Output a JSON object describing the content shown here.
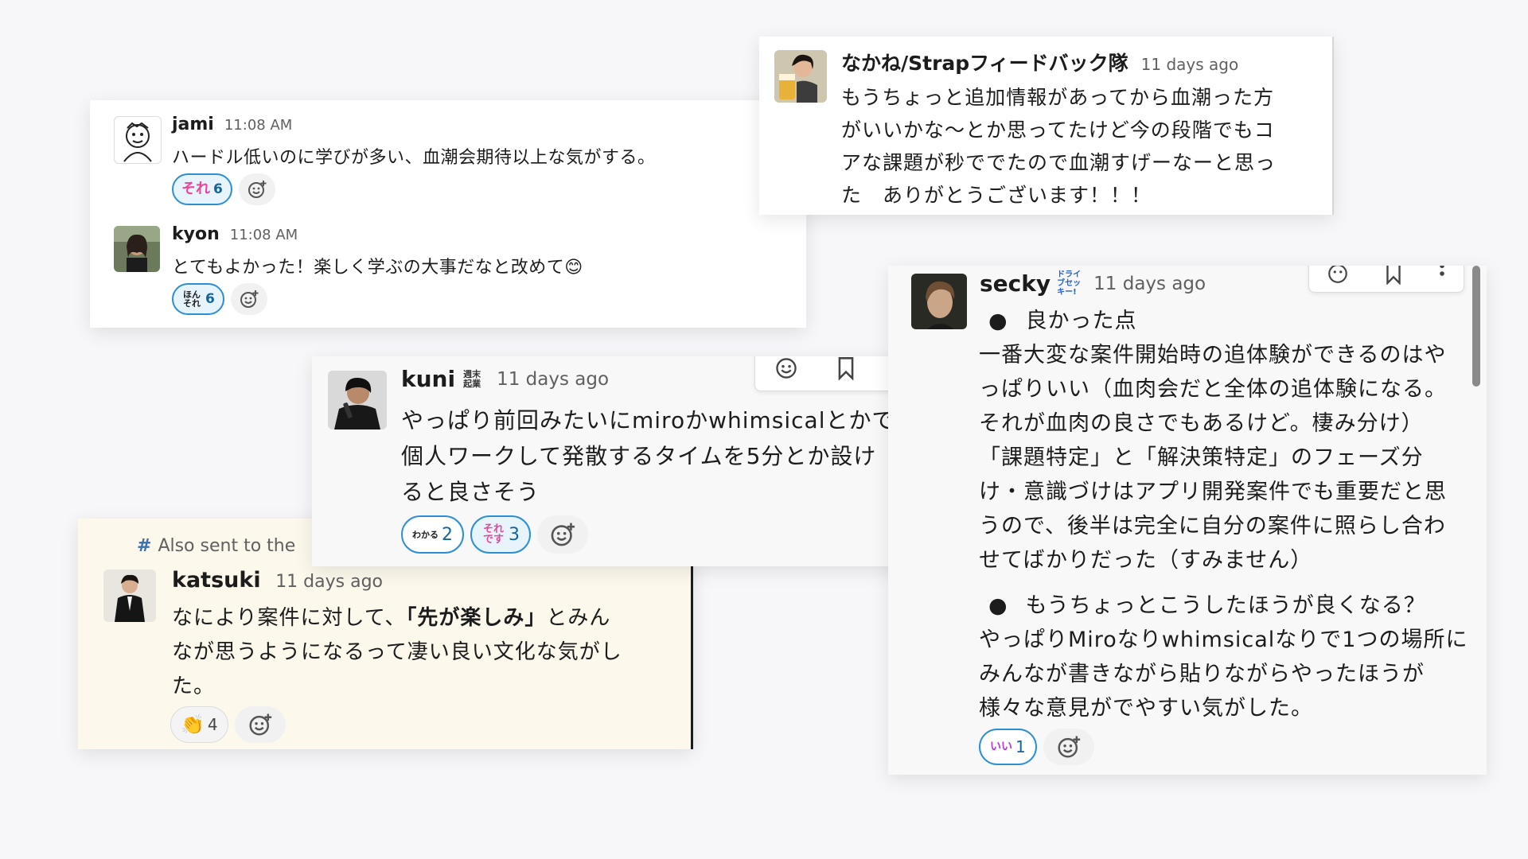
{
  "cards": {
    "jami_kyon": {
      "messages": [
        {
          "author": "jami",
          "time": "11:08 AM",
          "text": "ハードル低いのに学びが多い、血潮会期待以上な気がする。",
          "reactions": [
            {
              "emoji": "それ",
              "count": "6"
            }
          ]
        },
        {
          "author": "kyon",
          "time": "11:08 AM",
          "text": "とてもよかった！楽しく学ぶの大事だなと改めて",
          "emoji_end": "😊",
          "reactions": [
            {
              "emoji": "ほんそれ",
              "count": "6"
            }
          ]
        }
      ]
    },
    "nakane": {
      "author": "なかね/Strapフィードバック隊",
      "time": "11 days ago",
      "lines": [
        "もうちょっと追加情報があってから血潮った方",
        "がいいかな〜とか思ってたけど今の段階でもコ",
        "アな課題が秒ででたので血潮すげーなーと思っ",
        "た　ありがとうございます！！！"
      ]
    },
    "kuni": {
      "author": "kuni",
      "badge": "週末起業",
      "time": "11 days ago",
      "lines": [
        "やっぱり前回みたいにmiroかwhimsicalとかで",
        "個人ワークして発散するタイムを5分とか設け",
        "ると良さそう"
      ],
      "reactions": [
        {
          "emoji": "わかる",
          "count": "2"
        },
        {
          "emoji": "それです",
          "count": "3"
        }
      ]
    },
    "katsuki": {
      "also_sent": "Also sent to the",
      "author": "katsuki",
      "time": "11 days ago",
      "line1_before": "なにより案件に対して、",
      "line1_bold": "「先が楽しみ」",
      "line1_after": "とみん",
      "line2": "なが思うようになるって凄い良い文化な気がし",
      "line3": "た。",
      "reactions": [
        {
          "emoji": "👏",
          "count": "4"
        }
      ]
    },
    "secky": {
      "author": "secky",
      "badge": "ドライブセッキー!",
      "time": "11 days ago",
      "bullet1": "良かった点",
      "para1": [
        "一番大変な案件開始時の追体験ができるのはや",
        "っぱりいい（血肉会だと全体の追体験になる。",
        "それが血肉の良さでもあるけど。棲み分け）",
        "「課題特定」と「解決策特定」のフェーズ分",
        "け・意識づけはアプリ開発案件でも重要だと思",
        "うので、後半は完全に自分の案件に照らし合わ",
        "せてばかりだった（すみません）"
      ],
      "bullet2": "もうちょっとこうしたほうが良くなる？",
      "para2": [
        "やっぱりMiroなりwhimsicalなりで1つの場所に",
        "みんなが書きながら貼りながらやったほうが",
        "様々な意見がでやすい気がした。"
      ],
      "reactions": [
        {
          "emoji": "いい",
          "count": "1"
        }
      ]
    }
  },
  "colors": {
    "reaction_border": "#2c8fd6",
    "reaction_bg": "#e8f4fc",
    "pink": "#e8479a",
    "katsuki_bg": "#fcf8ec"
  }
}
